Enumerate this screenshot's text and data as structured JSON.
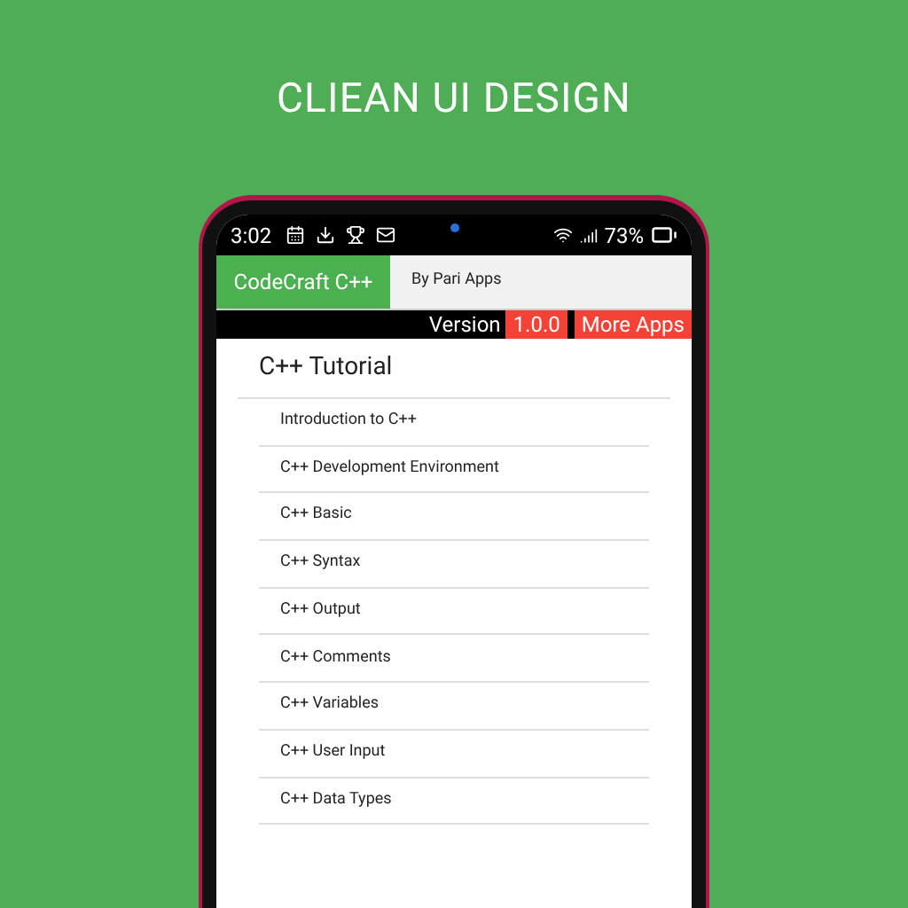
{
  "headline": "CLIEAN UI DESIGN",
  "status_bar": {
    "time": "3:02",
    "battery": "73%"
  },
  "app_header": {
    "title": "CodeCraft C++",
    "subtitle": "By Pari Apps"
  },
  "version_bar": {
    "label": "Version",
    "version": "1.0.0",
    "more_button": "More Apps"
  },
  "section_title": "C++ Tutorial",
  "items": [
    "Introduction to C++",
    "C++ Development Environment",
    "C++ Basic",
    "C++ Syntax",
    "C++ Output",
    "C++ Comments",
    "C++ Variables",
    "C++ User Input",
    "C++ Data Types"
  ]
}
